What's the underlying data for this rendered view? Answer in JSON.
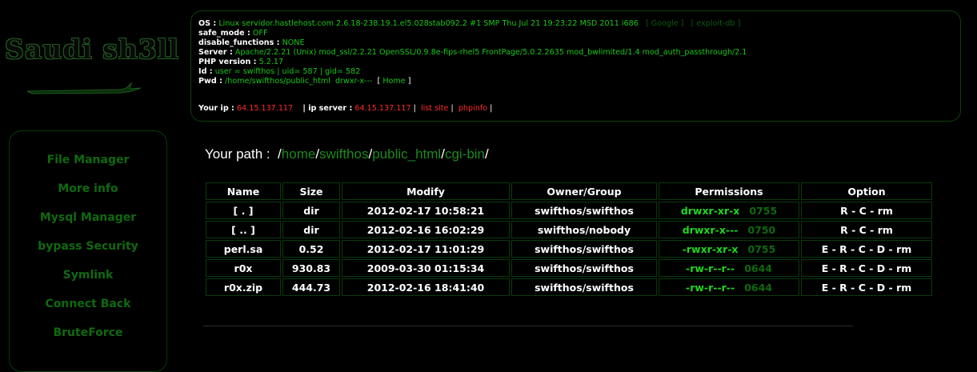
{
  "logo": {
    "text": "Saudi sh3ll"
  },
  "sidebar": {
    "items": [
      {
        "label": "File Manager"
      },
      {
        "label": "More info"
      },
      {
        "label": "Mysql Manager"
      },
      {
        "label": "bypass Security"
      },
      {
        "label": "Symlink"
      },
      {
        "label": "Connect Back"
      },
      {
        "label": "BruteForce"
      }
    ]
  },
  "info": {
    "os_label": "OS :",
    "os_value": "Linux servidor.hastlehost.com 2.6.18-238.19.1.el5.028stab092.2 #1 SMP Thu Jul 21 19:23:22 MSD 2011 i686",
    "google_link": "Google",
    "exploitdb_link": "exploit-db",
    "safe_mode_label": "safe_mode :",
    "safe_mode_value": "OFF",
    "disable_functions_label": "disable_functions :",
    "disable_functions_value": "NONE",
    "server_label": "Server :",
    "server_value": "Apache/2.2.21 (Unix) mod_ssl/2.2.21 OpenSSL/0.9.8e-fips-rhel5 FrontPage/5.0.2.2635 mod_bwlimited/1.4 mod_auth_passthrough/2.1",
    "php_label": "PHP version :",
    "php_value": "5.2.17",
    "id_label": "Id :",
    "id_value": "user = swifthos | uid= 587 | gid= 582",
    "pwd_label": "Pwd :",
    "pwd_value": "/home/swifthos/public_html",
    "pwd_perm": "drwxr-x---",
    "home_link": "Home",
    "your_ip_label": "Your ip :",
    "your_ip_value": "64.15.137.117",
    "ip_server_label": "| ip server :",
    "ip_server_value": "64.15.137.117",
    "list_site_link": "list site",
    "phpinfo_link": "phpinfo"
  },
  "path": {
    "label": "Your path :",
    "segments": [
      "home",
      "swifthos",
      "public_html",
      "cgi-bin"
    ]
  },
  "table": {
    "headers": [
      "Name",
      "Size",
      "Modify",
      "Owner/Group",
      "Permissions",
      "Option"
    ],
    "rows": [
      {
        "name": "[ . ]",
        "size": "dir",
        "modify": "2012-02-17 10:58:21",
        "owner": "swifthos/swifthos",
        "perm": "drwxr-xr-x",
        "octal": "0755",
        "options": [
          "R",
          "C",
          "rm"
        ]
      },
      {
        "name": "[ .. ]",
        "size": "dir",
        "modify": "2012-02-16 16:02:29",
        "owner": "swifthos/nobody",
        "perm": "drwxr-x---",
        "octal": "0750",
        "options": [
          "R",
          "C",
          "rm"
        ]
      },
      {
        "name": "perl.sa",
        "size": "0.52",
        "modify": "2012-02-17 11:01:29",
        "owner": "swifthos/swifthos",
        "perm": "-rwxr-xr-x",
        "octal": "0755",
        "options": [
          "E",
          "R",
          "C",
          "D",
          "rm"
        ]
      },
      {
        "name": "r0x",
        "size": "930.83",
        "modify": "2009-03-30 01:15:34",
        "owner": "swifthos/swifthos",
        "perm": "-rw-r--r--",
        "octal": "0644",
        "options": [
          "E",
          "R",
          "C",
          "D",
          "rm"
        ]
      },
      {
        "name": "r0x.zip",
        "size": "444.73",
        "modify": "2012-02-16 18:41:40",
        "owner": "swifthos/swifthos",
        "perm": "-rw-r--r--",
        "octal": "0644",
        "options": [
          "E",
          "R",
          "C",
          "D",
          "rm"
        ]
      }
    ]
  },
  "colors": {
    "background": "#000000",
    "accent_green": "#19c819",
    "dim_green": "#0e6a0e",
    "red": "#ff2a2a"
  }
}
